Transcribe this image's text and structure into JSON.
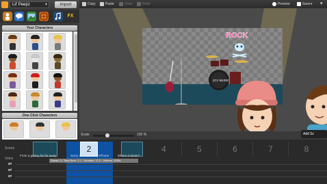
{
  "left_panel": {
    "theme_name": "Lil' Peepz",
    "import_label": "Import",
    "categories": [
      "people-icon",
      "speech-bubble-icon",
      "image-icon",
      "basketball-icon",
      "music-icon",
      "fx-icon"
    ],
    "fx_label": "FX",
    "characters_heading": "Your Characters",
    "one_click_heading": "One-Click Characters"
  },
  "toolbar": {
    "copy_label": "Copy",
    "paste_label": "Paste",
    "undo_label": "Undo",
    "redo_label": "Redo",
    "preview_label": "Preview",
    "save_label": "Save"
  },
  "stage": {
    "sign_text": "ROCK",
    "drum_text": "JCV MUSIC",
    "scale_label": "Scale",
    "scale_value": "100 %",
    "add_scene_label": "Add Sc"
  },
  "timeline": {
    "scene_row_label": "Scene",
    "voice_row_label": "Voice",
    "slot_numbers": [
      "2",
      "4",
      "5",
      "6",
      "7",
      "8"
    ],
    "captions": [
      "From a galaxy far far away",
      "Sorry, I was from my iPhone",
      "Where is Brian?"
    ],
    "info_strip": "Scene: 2 / Total Sum: 1.2 - Duration: 11.2 - Volume: 100%"
  },
  "colors": {
    "selected_scene": "#0e52a3",
    "accent_pink": "#e85c8a"
  }
}
